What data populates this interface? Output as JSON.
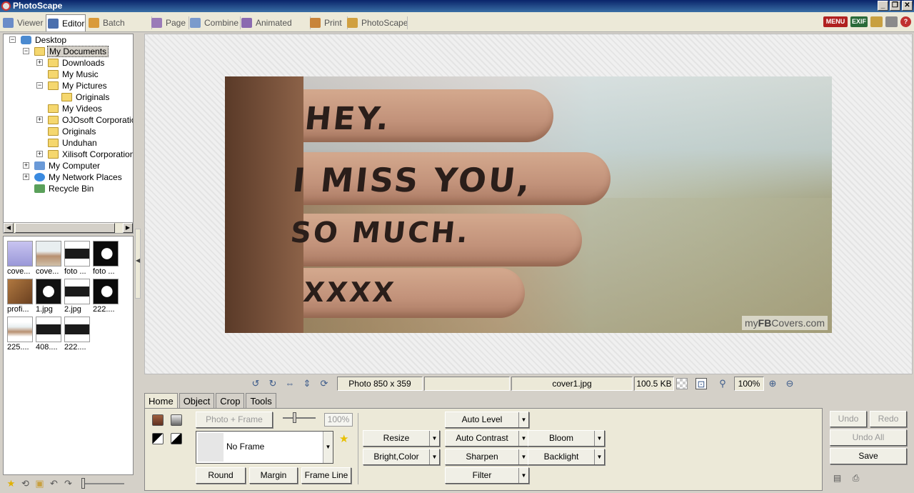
{
  "window": {
    "title": "PhotoScape"
  },
  "main_tabs": [
    {
      "label": "Viewer",
      "icon": "viewer-icon"
    },
    {
      "label": "Editor",
      "icon": "editor-icon",
      "active": true
    },
    {
      "label": "Batch Editor",
      "icon": "batch-editor-icon"
    },
    {
      "label": "Page",
      "icon": "page-icon"
    },
    {
      "label": "Combine",
      "icon": "combine-icon"
    },
    {
      "label": "Animated GIF",
      "icon": "animated-gif-icon"
    },
    {
      "label": "Print",
      "icon": "print-icon"
    },
    {
      "label": "PhotoScape",
      "icon": "photoscape-icon"
    }
  ],
  "top_icons": {
    "menu_label": "MENU",
    "exif_label": "EXIF",
    "help_label": "?"
  },
  "tree": [
    {
      "label": "Desktop",
      "level": 0,
      "expander": "−",
      "icon": "desktop-icon"
    },
    {
      "label": "My Documents",
      "level": 1,
      "expander": "−",
      "icon": "documents-icon",
      "selected": true
    },
    {
      "label": "Downloads",
      "level": 2,
      "expander": "+",
      "icon": "folder-icon"
    },
    {
      "label": "My Music",
      "level": 2,
      "expander": "",
      "icon": "music-folder-icon"
    },
    {
      "label": "My Pictures",
      "level": 2,
      "expander": "−",
      "icon": "pictures-folder-icon"
    },
    {
      "label": "Originals",
      "level": 3,
      "expander": "",
      "icon": "folder-icon"
    },
    {
      "label": "My Videos",
      "level": 2,
      "expander": "",
      "icon": "folder-icon"
    },
    {
      "label": "OJOsoft Corporatio",
      "level": 2,
      "expander": "+",
      "icon": "folder-icon"
    },
    {
      "label": "Originals",
      "level": 2,
      "expander": "",
      "icon": "folder-icon"
    },
    {
      "label": "Unduhan",
      "level": 2,
      "expander": "",
      "icon": "folder-icon"
    },
    {
      "label": "Xilisoft Corporation",
      "level": 2,
      "expander": "+",
      "icon": "folder-icon"
    },
    {
      "label": "My Computer",
      "level": 1,
      "expander": "+",
      "icon": "computer-icon"
    },
    {
      "label": "My Network Places",
      "level": 1,
      "expander": "+",
      "icon": "network-icon"
    },
    {
      "label": "Recycle Bin",
      "level": 1,
      "expander": "",
      "icon": "recycle-bin-icon"
    }
  ],
  "thumbnails": [
    {
      "caption": "cove...",
      "color": "#b7b4e8"
    },
    {
      "caption": "cove...",
      "color": "#c9b39a"
    },
    {
      "caption": "foto ...",
      "color": "#1a1a1a"
    },
    {
      "caption": "foto ...",
      "color": "#0a0a0a"
    },
    {
      "caption": "profi...",
      "color": "#8a5a30"
    },
    {
      "caption": "1.jpg",
      "color": "#111111"
    },
    {
      "caption": "2.jpg",
      "color": "#1a1a1a"
    },
    {
      "caption": "222....",
      "color": "#0a0a0a"
    },
    {
      "caption": "225....",
      "color": "#c9b39a"
    },
    {
      "caption": "408....",
      "color": "#1a1a1a"
    },
    {
      "caption": "222....",
      "color": "#1a1a1a"
    }
  ],
  "photo": {
    "line1": "HEY.",
    "line2": "I MISS YOU,",
    "line3": "SO MUCH.",
    "line4": "XXXX",
    "watermark_prefix": "my",
    "watermark_bold": "FB",
    "watermark_suffix": "Covers.com"
  },
  "status": {
    "dimensions": "Photo 850 x 359",
    "blank": "",
    "filename": "cover1.jpg",
    "filesize": "100.5 KB",
    "zoom": "100%"
  },
  "edit_tabs": [
    {
      "label": "Home",
      "active": true
    },
    {
      "label": "Object"
    },
    {
      "label": "Crop"
    },
    {
      "label": "Tools"
    }
  ],
  "home_panel": {
    "photo_frame_label": "Photo + Frame",
    "frame_percent": "100%",
    "frame_select": "No Frame",
    "round_label": "Round",
    "margin_label": "Margin",
    "frame_line_label": "Frame Line",
    "resize_label": "Resize",
    "bright_color_label": "Bright,Color",
    "auto_level_label": "Auto Level",
    "auto_contrast_label": "Auto Contrast",
    "sharpen_label": "Sharpen",
    "filter_label": "Filter",
    "bloom_label": "Bloom",
    "backlight_label": "Backlight"
  },
  "right_panel": {
    "undo_label": "Undo",
    "redo_label": "Redo",
    "undo_all_label": "Undo All",
    "save_label": "Save"
  }
}
